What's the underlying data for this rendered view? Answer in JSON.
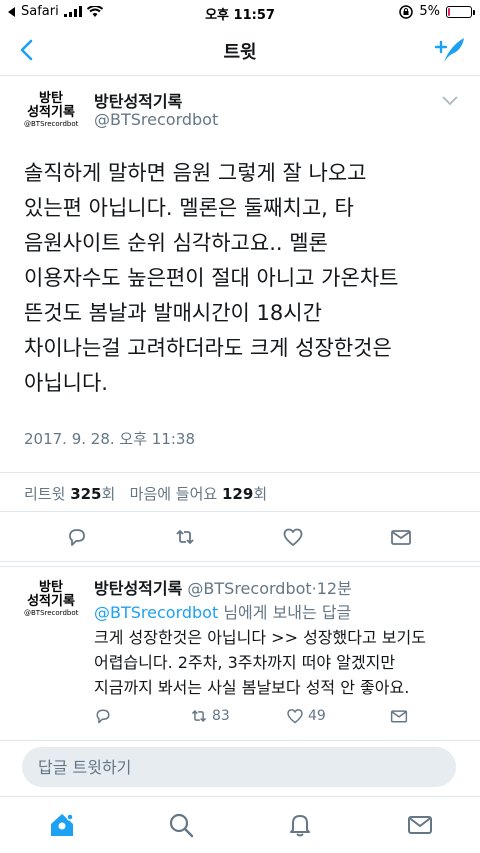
{
  "status_bar": {
    "carrier": "Safari",
    "time": "오후 11:57",
    "battery": "5%",
    "battery_level": 0.05
  },
  "nav": {
    "title": "트윗",
    "icons": {
      "back": "chevron-left-icon",
      "compose": "compose-tweet-icon"
    }
  },
  "main_tweet": {
    "logo": {
      "line1": "방탄",
      "line2": "성적기록",
      "line3": "@BTSrecordbot"
    },
    "author_name": "방탄성적기록",
    "author_handle": "@BTSrecordbot",
    "text": "솔직하게 말하면 음원 그렇게 잘 나오고\n있는편 아닙니다. 멜론은 둘째치고, 타\n음원사이트 순위 심각하고요.. 멜론\n이용자수도 높은편이 절대 아니고 가온차트\n뜬것도 봄날과 발매시간이 18시간\n차이나는걸 고려하더라도 크게 성장한것은\n아닙니다.",
    "timestamp": "2017. 9. 28. 오후 11:38",
    "stats": {
      "retweet_label": "리트윗",
      "retweet_count": "325",
      "retweet_unit": "회",
      "like_label": "마음에 들어요",
      "like_count": "129",
      "like_unit": "회"
    }
  },
  "reply_tweet": {
    "logo": {
      "line1": "방탄",
      "line2": "성적기록",
      "line3": "@BTSrecordbot"
    },
    "author_name": "방탄성적기록",
    "author_handle": "@BTSrecordbot",
    "separator": "·",
    "age": "12분",
    "reply_to_handle": "@BTSrecordbot",
    "reply_to_suffix": "님에게 보내는 답글",
    "text": "크게 성장한것은 아닙니다 >> 성장했다고 보기도\n어렵습니다. 2주차, 3주차까지 떠야 알겠지만\n지금까지 봐서는 사실 봄날보다 성적 안 좋아요.",
    "retweet_count": "83",
    "like_count": "49"
  },
  "reply_bar": {
    "placeholder": "답글 트윗하기"
  },
  "colors": {
    "accent": "#1da1f2",
    "secondary_text": "#657786",
    "border": "#e1e8ed"
  }
}
